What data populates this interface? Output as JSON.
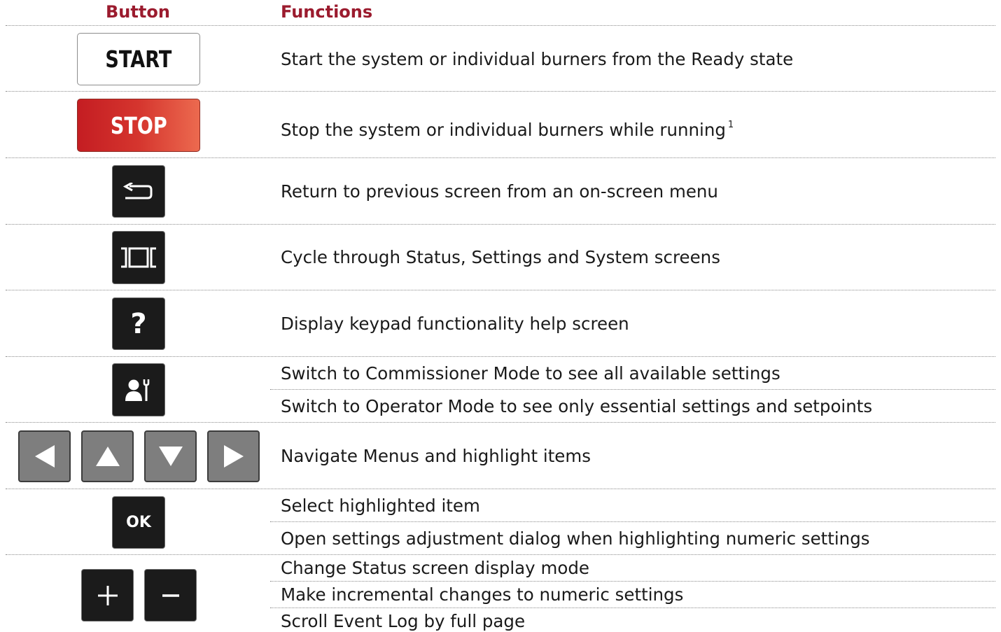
{
  "headers": {
    "button": "Button",
    "functions": "Functions"
  },
  "buttons": {
    "start_label": "START",
    "stop_label": "STOP",
    "help_label": "?",
    "ok_label": "OK"
  },
  "functions": {
    "start": "Start the system or individual burners from the Ready state",
    "stop": "Stop the system or individual burners while running",
    "stop_footnote": "1",
    "back": "Return to previous screen from an on-screen menu",
    "screens": "Cycle through Status, Settings and System screens",
    "help": "Display keypad functionality help screen",
    "mode_commissioner": "Switch to Commissioner Mode to see all available settings",
    "mode_operator": "Switch to Operator Mode to see only essential settings and setpoints",
    "navigate": "Navigate Menus and highlight items",
    "ok_select": "Select highlighted item",
    "ok_open": "Open settings adjustment dialog when highlighting numeric settings",
    "plusminus_status": "Change Status screen display mode",
    "plusminus_increment": "Make incremental changes to numeric settings",
    "plusminus_scroll": "Scroll Event Log by full page"
  },
  "colors": {
    "header_text": "#9b1b2e",
    "key_background": "#1b1b1b",
    "arrow_key_background": "#7e7e7e",
    "stop_gradient_start": "#c41d22",
    "stop_gradient_end": "#ec6a4f"
  },
  "icons": {
    "back": "return-arrow-icon",
    "screens": "cycle-screens-icon",
    "mode": "person-wrench-icon",
    "left": "left-triangle-icon",
    "up": "up-triangle-icon",
    "down": "down-triangle-icon",
    "right": "right-triangle-icon",
    "plus": "plus-icon",
    "minus": "minus-icon"
  }
}
